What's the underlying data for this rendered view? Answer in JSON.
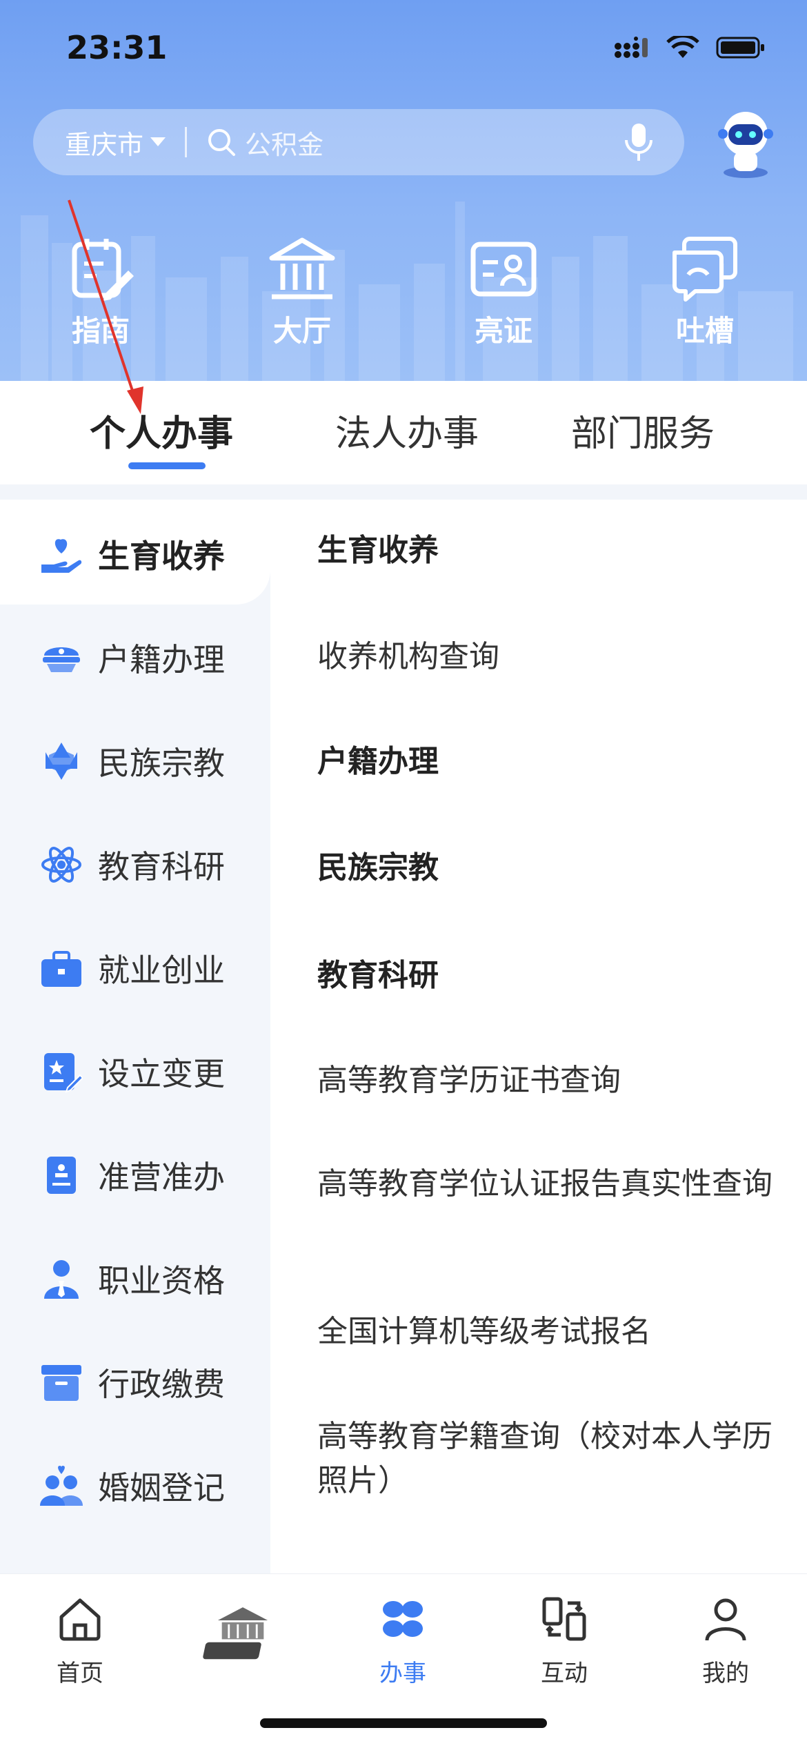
{
  "status": {
    "time": "23:31"
  },
  "search": {
    "city": "重庆市",
    "placeholder": "公积金"
  },
  "shortcuts": [
    {
      "label": "指南",
      "icon": "guide-icon"
    },
    {
      "label": "大厅",
      "icon": "hall-icon"
    },
    {
      "label": "亮证",
      "icon": "certificate-icon"
    },
    {
      "label": "吐槽",
      "icon": "feedback-icon"
    }
  ],
  "tabs": [
    {
      "label": "个人办事",
      "active": true
    },
    {
      "label": "法人办事",
      "active": false
    },
    {
      "label": "部门服务",
      "active": false
    }
  ],
  "sidebar": {
    "items": [
      {
        "label": "生育收养",
        "icon": "childbirth-icon",
        "active": true
      },
      {
        "label": "户籍办理",
        "icon": "police-cap-icon"
      },
      {
        "label": "民族宗教",
        "icon": "star-icon"
      },
      {
        "label": "教育科研",
        "icon": "atom-icon"
      },
      {
        "label": "就业创业",
        "icon": "briefcase-icon"
      },
      {
        "label": "设立变更",
        "icon": "document-edit-icon"
      },
      {
        "label": "准营准办",
        "icon": "license-icon"
      },
      {
        "label": "职业资格",
        "icon": "professional-icon"
      },
      {
        "label": "行政缴费",
        "icon": "archive-box-icon"
      },
      {
        "label": "婚姻登记",
        "icon": "couple-icon"
      }
    ]
  },
  "content": {
    "items": [
      {
        "label": "生育收养",
        "type": "heading"
      },
      {
        "label": "收养机构查询",
        "type": "link"
      },
      {
        "label": "户籍办理",
        "type": "heading"
      },
      {
        "label": "民族宗教",
        "type": "heading"
      },
      {
        "label": "教育科研",
        "type": "heading"
      },
      {
        "label": "高等教育学历证书查询",
        "type": "link"
      },
      {
        "label": "高等教育学位认证报告真实性查询",
        "type": "link"
      },
      {
        "label": "全国计算机等级考试报名",
        "type": "link"
      },
      {
        "label": "高等教育学籍查询（校对本人学历照片）",
        "type": "link"
      }
    ]
  },
  "bottom_nav": {
    "items": [
      {
        "label": "首页",
        "icon": "home-icon"
      },
      {
        "label": "",
        "icon": "yukuaiban-logo-icon"
      },
      {
        "label": "办事",
        "icon": "services-icon",
        "active": true
      },
      {
        "label": "互动",
        "icon": "interaction-icon"
      },
      {
        "label": "我的",
        "icon": "profile-icon"
      }
    ]
  },
  "colors": {
    "accent": "#3d7cf2",
    "header": "#7aa8f4",
    "sidebar_bg": "#f3f6fb",
    "annotation": "#e0342c"
  }
}
